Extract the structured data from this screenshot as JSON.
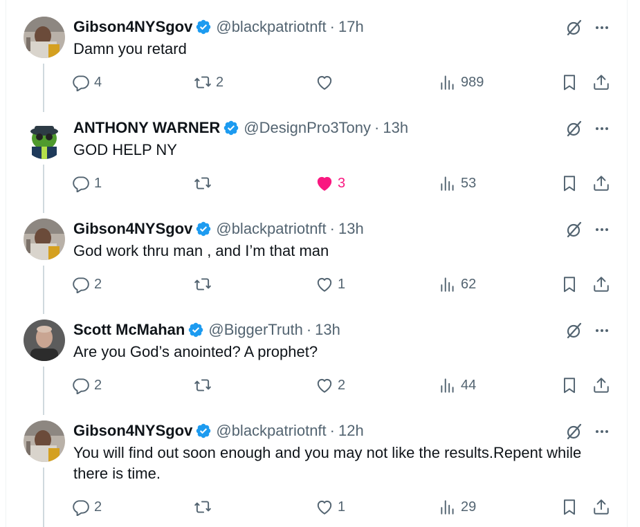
{
  "tweets": [
    {
      "name": "Gibson4NYSgov",
      "handle": "@blackpatriotnft",
      "time": "17h",
      "text": "Damn you retard",
      "replies": "4",
      "retweets": "2",
      "likes": "",
      "views": "989",
      "liked": false
    },
    {
      "name": "ANTHONY WARNER",
      "handle": "@DesignPro3Tony",
      "time": "13h",
      "text": "GOD HELP NY",
      "replies": "1",
      "retweets": "",
      "likes": "3",
      "views": "53",
      "liked": true
    },
    {
      "name": "Gibson4NYSgov",
      "handle": "@blackpatriotnft",
      "time": "13h",
      "text": "God work thru man , and I’m that man",
      "replies": "2",
      "retweets": "",
      "likes": "1",
      "views": "62",
      "liked": false
    },
    {
      "name": "Scott McMahan",
      "handle": "@BiggerTruth",
      "time": "13h",
      "text": "Are you God’s anointed? A prophet?",
      "replies": "2",
      "retweets": "",
      "likes": "2",
      "views": "44",
      "liked": false
    },
    {
      "name": "Gibson4NYSgov",
      "handle": "@blackpatriotnft",
      "time": "12h",
      "text": "You will find out soon enough and you may not like the results.Repent while there is time.",
      "replies": "2",
      "retweets": "",
      "likes": "1",
      "views": "29",
      "liked": false
    }
  ],
  "separator": "·",
  "colors": {
    "text": "#0f1419",
    "muted": "#536471",
    "verified": "#1d9bf0",
    "like_active": "#f91880",
    "thread_line": "#cfd9de"
  },
  "icons": [
    "verified-badge-icon",
    "grok-icon",
    "more-icon",
    "reply-icon",
    "retweet-icon",
    "like-icon",
    "views-icon",
    "bookmark-icon",
    "share-icon"
  ]
}
